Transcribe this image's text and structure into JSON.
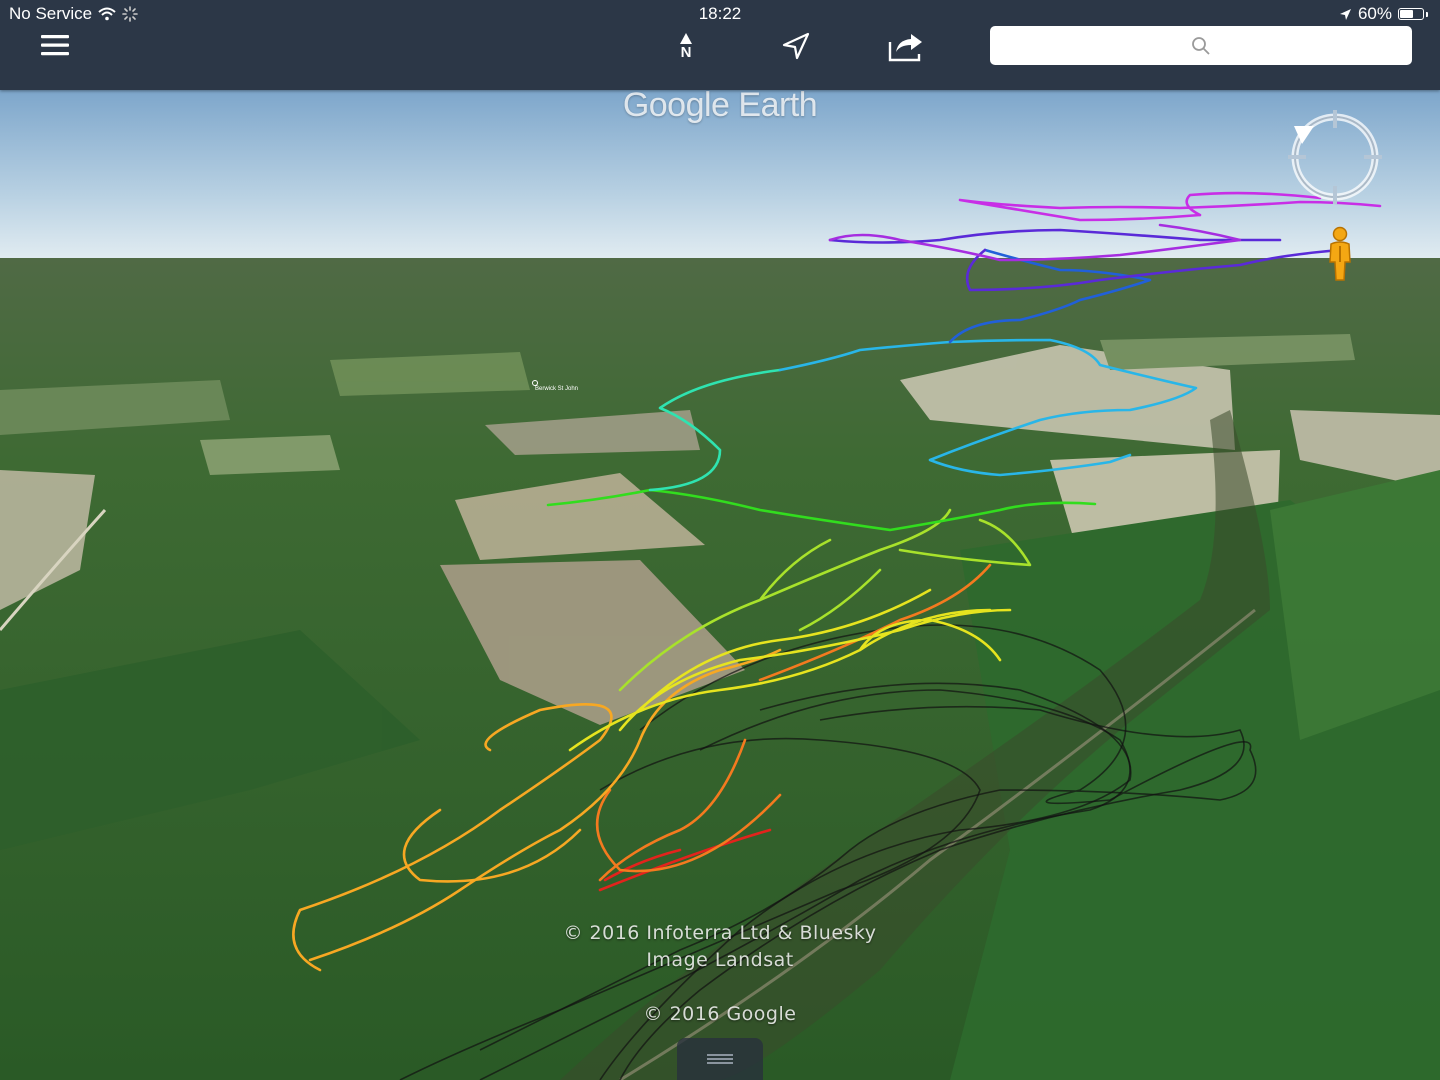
{
  "status_bar": {
    "carrier": "No Service",
    "time": "18:22",
    "battery": "60%",
    "battery_level": 0.6
  },
  "toolbar": {
    "menu_icon": "hamburger-menu-icon",
    "north_label": "N",
    "north_icon": "north-compass-icon",
    "location_icon": "location-arrow-icon",
    "share_icon": "share-icon",
    "search_icon": "search-icon",
    "search_value": ""
  },
  "map": {
    "brand": "Google Earth",
    "place_name": "Berwick St John",
    "attribution_lines": [
      "© 2016 Infoterra Ltd & Bluesky",
      "Image Landsat"
    ],
    "copyright": "© 2016 Google",
    "compass_icon": "view-compass-icon",
    "pegman_icon": "street-view-pegman-icon",
    "drawer_icon": "drawer-handle-icon",
    "track_colors": [
      "#e3231c",
      "#f47a1f",
      "#f7a823",
      "#e6e41f",
      "#a8e22b",
      "#32dd1e",
      "#2fe3b0",
      "#29b6e8",
      "#2160d9",
      "#5a2ad8",
      "#a62de0",
      "#c82ee6"
    ],
    "shadow_color": "#111111"
  }
}
